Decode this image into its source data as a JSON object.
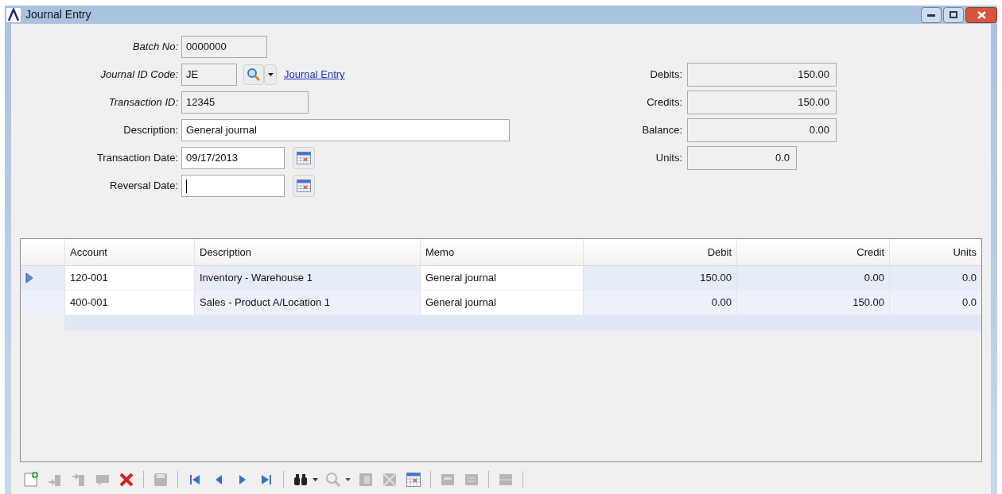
{
  "window": {
    "title": "Journal Entry"
  },
  "form": {
    "left": [
      {
        "label": "Batch No:",
        "value": "0000000",
        "kind": "readonly"
      },
      {
        "label": "Journal ID Code:",
        "value": "JE",
        "kind": "lookup",
        "link": "Journal Entry"
      },
      {
        "label": "Transaction ID:",
        "value": "12345",
        "kind": "readonly"
      },
      {
        "label": "Description:",
        "value": "General journal",
        "kind": "input"
      },
      {
        "label": "Transaction Date:",
        "value": "09/17/2013",
        "kind": "date"
      },
      {
        "label": "Reversal Date:",
        "kind": "date",
        "focused": true
      }
    ],
    "right": [
      {
        "label": "Debits:",
        "value": "150.00"
      },
      {
        "label": "Credits:",
        "value": "150.00"
      },
      {
        "label": "Balance:",
        "value": "0.00"
      },
      {
        "label": "Units:",
        "value": "0.0"
      }
    ]
  },
  "table": {
    "columns": [
      "Account",
      "Description",
      "Memo",
      "Debit",
      "Credit",
      "Units"
    ],
    "rows": [
      {
        "selected": true,
        "cells": [
          "120-001",
          "Inventory - Warehouse 1",
          "General journal",
          "150.00",
          "0.00",
          "0.0"
        ]
      },
      {
        "selected": false,
        "cells": [
          "400-001",
          "Sales - Product A/Location 1",
          "General journal",
          "0.00",
          "150.00",
          "0.0"
        ]
      }
    ]
  },
  "toolbar": [
    [
      {
        "disabled": false
      },
      {
        "disabled": true
      },
      {
        "disabled": true
      },
      {
        "disabled": true
      },
      {
        "disabled": false
      }
    ],
    [
      {
        "disabled": true
      }
    ],
    [
      {
        "disabled": false
      },
      {
        "disabled": false
      },
      {
        "disabled": false
      },
      {
        "disabled": false
      }
    ],
    [
      {
        "disabled": false,
        "dropdown": true
      },
      {
        "disabled": true,
        "dropdown": true
      },
      {
        "disabled": true
      },
      {
        "disabled": true
      },
      {
        "disabled": false
      }
    ],
    [
      {
        "disabled": true
      },
      {
        "disabled": true
      }
    ],
    [
      {
        "disabled": true
      }
    ]
  ]
}
